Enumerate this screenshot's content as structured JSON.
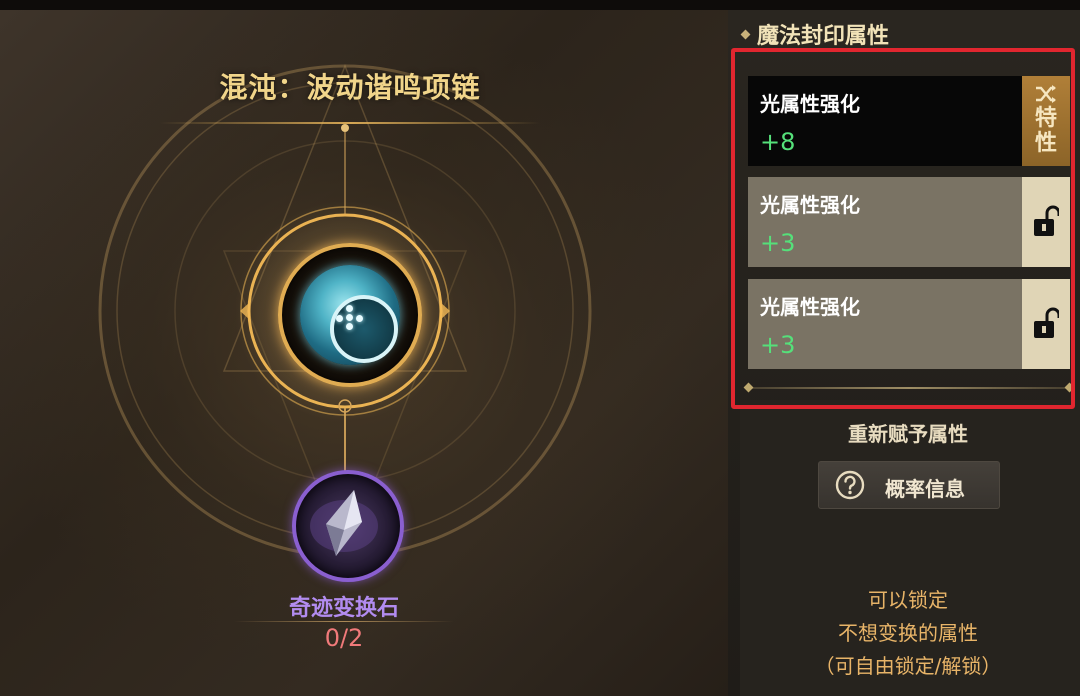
{
  "item": {
    "title": "混沌：波动谐鸣项链"
  },
  "material": {
    "name": "奇迹变换石",
    "count": "0/2"
  },
  "seal_panel": {
    "header": "魔法封印属性",
    "attributes": [
      {
        "name": "光属性强化",
        "value": "+8",
        "side": "trait",
        "side_label": "特性",
        "locked": false
      },
      {
        "name": "光属性强化",
        "value": "+3",
        "side": "lock",
        "locked": false
      },
      {
        "name": "光属性强化",
        "value": "+3",
        "side": "lock",
        "locked": false
      }
    ],
    "highlight_color": "#e1262f"
  },
  "actions": {
    "reassign_label": "重新赋予属性",
    "probability_button": "概率信息"
  },
  "hint": {
    "line1": "可以锁定",
    "line2": "不想变换的属性",
    "line3": "（可自由锁定/解锁）"
  },
  "colors": {
    "title_gold": "#f1d58a",
    "value_green": "#55e07a",
    "material_purple": "#b28cf0",
    "count_red": "#f07a7a",
    "hint_orange": "#e8b468"
  },
  "icons": {
    "shuffle": "shuffle-icon",
    "lock": "unlocked-padlock-icon",
    "help": "question-circle-icon"
  }
}
